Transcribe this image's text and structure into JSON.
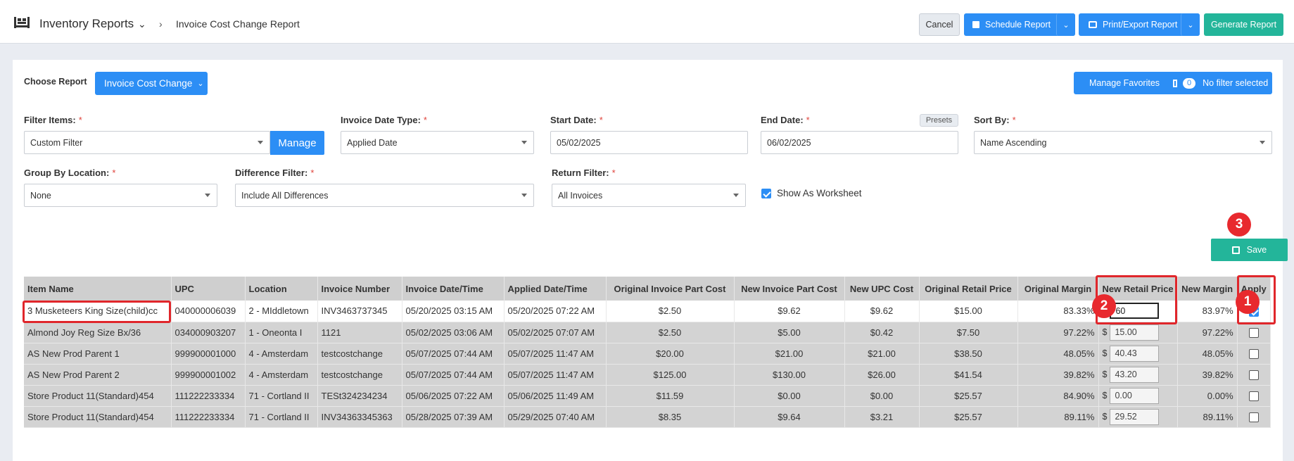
{
  "header": {
    "app_title": "Inventory Reports",
    "breadcrumb": "Invoice Cost Change Report",
    "cancel_label": "Cancel",
    "schedule_label": "Schedule Report",
    "print_label": "Print/Export Report",
    "generate_label": "Generate Report"
  },
  "toolbar": {
    "choose_report_label": "Choose Report",
    "report_selected": "Invoice Cost Change",
    "manage_favorites_label": "Manage Favorites",
    "filter_count": "0",
    "filter_label": "No filter selected"
  },
  "filters": {
    "filter_items_label": "Filter Items:",
    "filter_items_value": "Custom Filter",
    "manage_label": "Manage",
    "invoice_date_type_label": "Invoice Date Type:",
    "invoice_date_type_value": "Applied Date",
    "start_date_label": "Start Date:",
    "start_date_value": "05/02/2025",
    "end_date_label": "End Date:",
    "end_date_value": "06/02/2025",
    "presets_label": "Presets",
    "sort_by_label": "Sort By:",
    "sort_by_value": "Name Ascending",
    "group_by_label": "Group By Location:",
    "group_by_value": "None",
    "difference_label": "Difference Filter:",
    "difference_value": "Include All Differences",
    "return_label": "Return Filter:",
    "return_value": "All Invoices",
    "show_worksheet_label": "Show As Worksheet",
    "required_mark": "*"
  },
  "save_label": "Save",
  "table": {
    "columns": [
      "Item Name",
      "UPC",
      "Location",
      "Invoice Number",
      "Invoice Date/Time",
      "Applied Date/Time",
      "Original Invoice Part Cost",
      "New Invoice Part Cost",
      "New UPC Cost",
      "Original Retail Price",
      "Original Margin",
      "New Retail Price",
      "New Margin",
      "Apply"
    ],
    "currency": "$",
    "rows": [
      {
        "item": "3 Musketeers King Size(child)cc",
        "upc": "040000006039",
        "location": "2 - MIddletown",
        "invoice": "INV3463737345",
        "invoice_dt": "05/20/2025 03:15 AM",
        "applied_dt": "05/20/2025 07:22 AM",
        "orig_part": "$2.50",
        "new_part": "$9.62",
        "new_upc": "$9.62",
        "orig_retail": "$15.00",
        "orig_margin": "83.33%",
        "new_retail": "60",
        "new_margin": "83.97%",
        "apply": true
      },
      {
        "item": "Almond Joy Reg Size Bx/36",
        "upc": "034000903207",
        "location": "1 - Oneonta I",
        "invoice": "1121",
        "invoice_dt": "05/02/2025 03:06 AM",
        "applied_dt": "05/02/2025 07:07 AM",
        "orig_part": "$2.50",
        "new_part": "$5.00",
        "new_upc": "$0.42",
        "orig_retail": "$7.50",
        "orig_margin": "97.22%",
        "new_retail": "15.00",
        "new_margin": "97.22%",
        "apply": false
      },
      {
        "item": "AS New Prod Parent 1",
        "upc": "999900001000",
        "location": "4 - Amsterdam",
        "invoice": "testcostchange",
        "invoice_dt": "05/07/2025 07:44 AM",
        "applied_dt": "05/07/2025 11:47 AM",
        "orig_part": "$20.00",
        "new_part": "$21.00",
        "new_upc": "$21.00",
        "orig_retail": "$38.50",
        "orig_margin": "48.05%",
        "new_retail": "40.43",
        "new_margin": "48.05%",
        "apply": false
      },
      {
        "item": "AS New Prod Parent 2",
        "upc": "999900001002",
        "location": "4 - Amsterdam",
        "invoice": "testcostchange",
        "invoice_dt": "05/07/2025 07:44 AM",
        "applied_dt": "05/07/2025 11:47 AM",
        "orig_part": "$125.00",
        "new_part": "$130.00",
        "new_upc": "$26.00",
        "orig_retail": "$41.54",
        "orig_margin": "39.82%",
        "new_retail": "43.20",
        "new_margin": "39.82%",
        "apply": false
      },
      {
        "item": "Store Product 11(Standard)454",
        "upc": "111222233334",
        "location": "71 - Cortland II",
        "invoice": "TESt324234234",
        "invoice_dt": "05/06/2025 07:22 AM",
        "applied_dt": "05/06/2025 11:49 AM",
        "orig_part": "$11.59",
        "new_part": "$0.00",
        "new_upc": "$0.00",
        "orig_retail": "$25.57",
        "orig_margin": "84.90%",
        "new_retail": "0.00",
        "new_margin": "0.00%",
        "apply": false
      },
      {
        "item": "Store Product 11(Standard)454",
        "upc": "111222233334",
        "location": "71 - Cortland II",
        "invoice": "INV34363345363",
        "invoice_dt": "05/28/2025 07:39 AM",
        "applied_dt": "05/29/2025 07:40 AM",
        "orig_part": "$8.35",
        "new_part": "$9.64",
        "new_upc": "$3.21",
        "orig_retail": "$25.57",
        "orig_margin": "89.11%",
        "new_retail": "29.52",
        "new_margin": "89.11%",
        "apply": false
      }
    ]
  },
  "annotations": {
    "marker_1": "1",
    "marker_2": "2",
    "marker_3": "3",
    "color": "#e0262b"
  },
  "colors": {
    "primary": "#2c8ef5",
    "success": "#23b59a",
    "required": "#e0443c"
  }
}
